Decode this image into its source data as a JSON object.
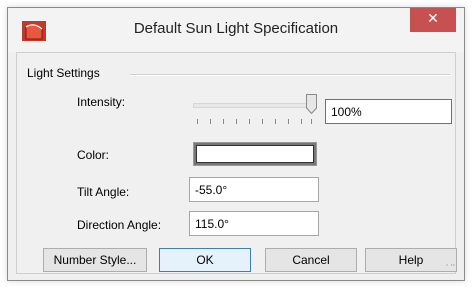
{
  "window": {
    "title": "Default Sun Light Specification",
    "close_label": "✕"
  },
  "group": {
    "label": "Light Settings"
  },
  "fields": {
    "intensity_label": "Intensity:",
    "intensity_value": "100%",
    "intensity_level": 1.0,
    "color_label": "Color:",
    "color_value": "#ffffff",
    "tilt_label": "Tilt Angle:",
    "tilt_value": "-55.0°",
    "direction_label": "Direction Angle:",
    "direction_value": "115.0°"
  },
  "buttons": {
    "number_style": "Number Style...",
    "ok": "OK",
    "cancel": "Cancel",
    "help": "Help"
  },
  "colors": {
    "close_button": "#c75050",
    "app_icon": "#c0392b",
    "focus_border": "#3c7fb1"
  }
}
